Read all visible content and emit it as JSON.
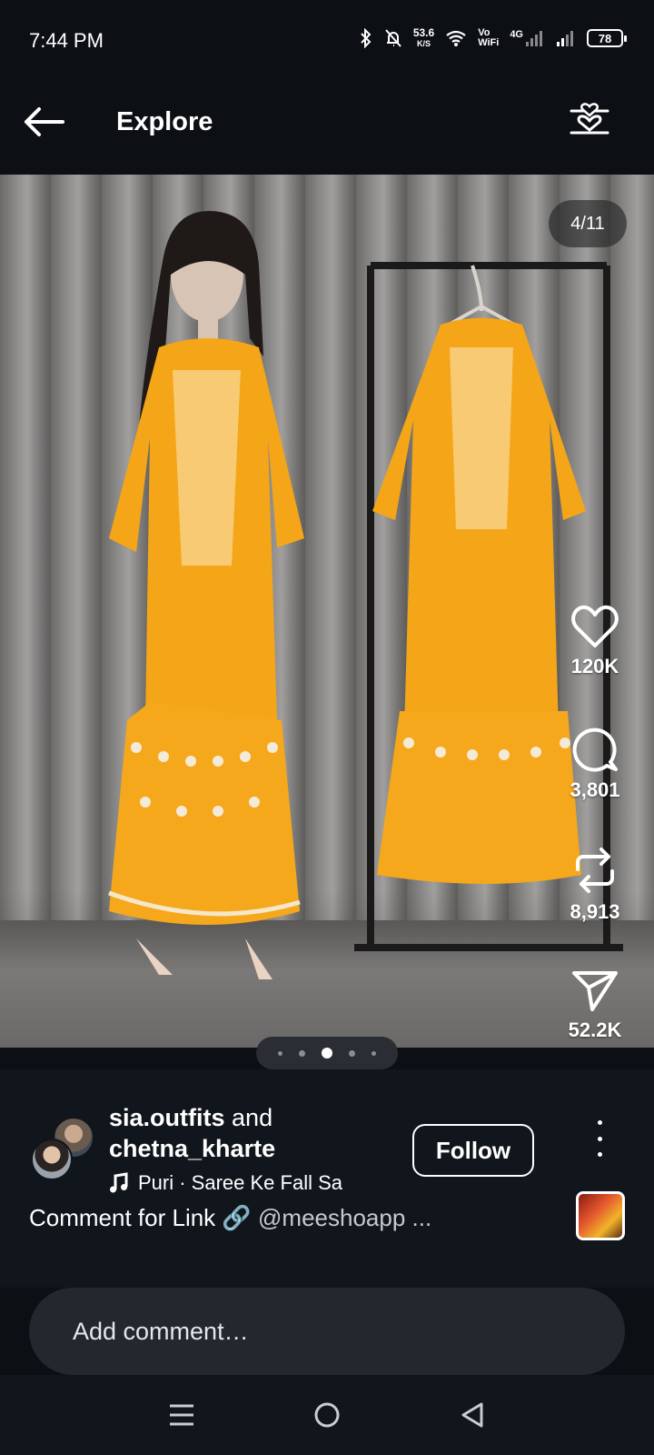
{
  "status_bar": {
    "time": "7:44 PM",
    "net_speed_value": "53.6",
    "net_speed_unit": "K/S",
    "volte_top": "Vo",
    "volte_bottom": "WiFi",
    "network_type": "4G",
    "battery": "78"
  },
  "header": {
    "title": "Explore",
    "back_icon": "arrow-left-icon",
    "filter_icon": "heart-sliders-icon"
  },
  "media": {
    "counter": "4/11",
    "dots_total": 5,
    "dots_active_index": 2
  },
  "actions": {
    "like_count": "120K",
    "comment_count": "3,801",
    "repost_count": "8,913",
    "share_count": "52.2K"
  },
  "post": {
    "author_primary": "sia.outfits",
    "author_connector": "and",
    "author_secondary": "chetna_kharte",
    "audio": "Puri · Saree Ke Fall Sa",
    "follow_label": "Follow",
    "caption_main": "Comment for Link 🔗",
    "caption_tail": "@meeshoapp ..."
  },
  "comment": {
    "placeholder": "Add comment…"
  },
  "colors": {
    "background": "#0c0f14",
    "outfit": "#f4a618",
    "accent_white": "#ffffff"
  }
}
